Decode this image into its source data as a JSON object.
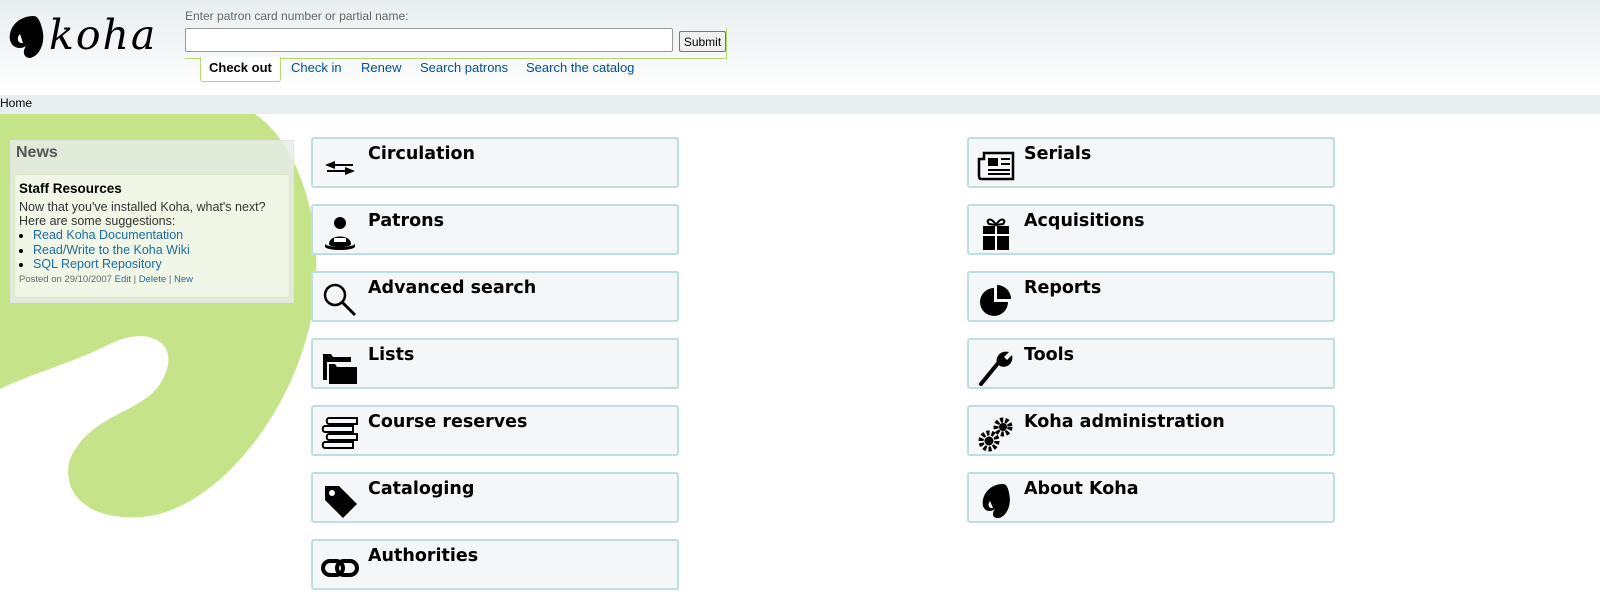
{
  "header": {
    "logo_text": "koha",
    "search_label": "Enter patron card number or partial name:",
    "search_value": "",
    "submit_label": "Submit",
    "tabs": [
      {
        "label": "Check out",
        "active": true
      },
      {
        "label": "Check in"
      },
      {
        "label": "Renew"
      },
      {
        "label": "Search patrons"
      },
      {
        "label": "Search the catalog"
      }
    ]
  },
  "breadcrumb": {
    "home": "Home"
  },
  "news": {
    "title": "News",
    "item_title": "Staff Resources",
    "item_text": "Now that you've installed Koha, what's next? Here are some suggestions:",
    "links": [
      "Read Koha Documentation",
      "Read/Write to the Koha Wiki",
      "SQL Report Repository"
    ],
    "posted": "Posted on 29/10/2007",
    "actions": [
      "Edit",
      "Delete",
      "New"
    ]
  },
  "modules_left": [
    {
      "label": "Circulation",
      "icon": "circulation-icon"
    },
    {
      "label": "Patrons",
      "icon": "patrons-icon"
    },
    {
      "label": "Advanced search",
      "icon": "search-icon"
    },
    {
      "label": "Lists",
      "icon": "folder-icon"
    },
    {
      "label": "Course reserves",
      "icon": "books-icon"
    },
    {
      "label": "Cataloging",
      "icon": "tag-icon"
    },
    {
      "label": "Authorities",
      "icon": "link-icon"
    }
  ],
  "modules_right": [
    {
      "label": "Serials",
      "icon": "newspaper-icon"
    },
    {
      "label": "Acquisitions",
      "icon": "gift-icon"
    },
    {
      "label": "Reports",
      "icon": "pie-chart-icon"
    },
    {
      "label": "Tools",
      "icon": "wrench-icon"
    },
    {
      "label": "Koha administration",
      "icon": "gears-icon"
    },
    {
      "label": "About Koha",
      "icon": "koha-logo-icon"
    }
  ],
  "colors": {
    "accent_green": "#c5e48a",
    "link": "#004d99",
    "module_border": "#bddfe2"
  }
}
